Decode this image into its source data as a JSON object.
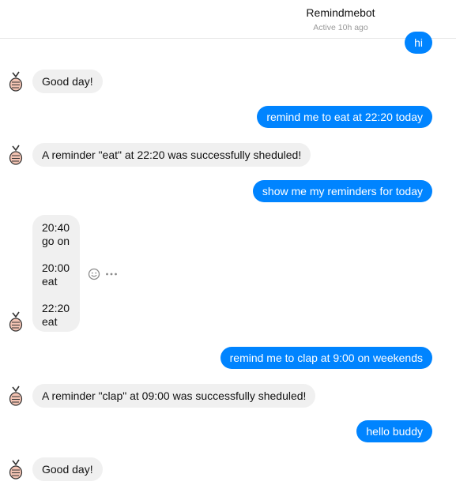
{
  "header": {
    "title": "Remindmebot",
    "status": "Active 10h ago"
  },
  "messages": {
    "m1": "hi",
    "m2": "Good day!",
    "m3": "remind me to eat at 22:20 today",
    "m4": "A reminder \"eat\" at 22:20  was successfully sheduled!",
    "m5": "show me my reminders for today",
    "list": {
      "t1": "20:40",
      "n1": "go on",
      "t2": "20:00",
      "n2": "eat",
      "t3": "22:20",
      "n3": "eat"
    },
    "m7": "remind me to clap at 9:00 on weekends",
    "m8": "A reminder \"clap\" at 09:00  was successfully sheduled!",
    "m9": "hello buddy",
    "m10": "Good day!"
  },
  "icons": {
    "avatar": "bot-avatar-icon",
    "react": "emoji-react-icon",
    "more": "more-options-icon"
  },
  "colors": {
    "outgoing": "#0084ff",
    "incoming": "#f0f0f0",
    "status_text": "#9a9a9a"
  }
}
